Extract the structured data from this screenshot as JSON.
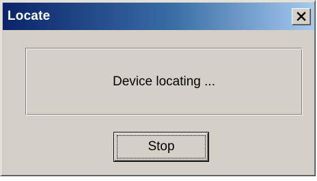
{
  "window": {
    "title": "Locate",
    "close_glyph": "close-icon"
  },
  "status": {
    "message": "Device locating ..."
  },
  "actions": {
    "stop_label": "Stop"
  },
  "colors": {
    "titlebar_start": "#0a246a",
    "titlebar_end": "#a6caf0",
    "face": "#d4d0c8"
  }
}
